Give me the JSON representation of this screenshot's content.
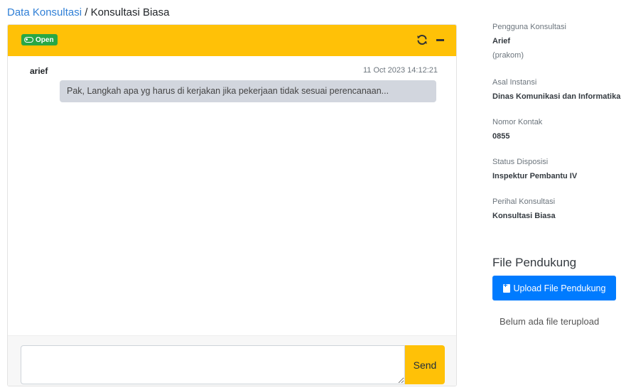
{
  "breadcrumb": {
    "parent": "Data Konsultasi",
    "separator": "/",
    "current": "Konsultasi Biasa"
  },
  "chat": {
    "status": "Open",
    "messages": [
      {
        "sender": "arief",
        "timestamp": "11 Oct 2023 14:12:21",
        "text": "Pak, Langkah apa yg harus di kerjakan jika pekerjaan tidak sesuai perencanaan..."
      }
    ],
    "input": {
      "value": "",
      "placeholder": ""
    },
    "send_label": "Send",
    "icons": {
      "refresh": "refresh-icon",
      "collapse": "minus-icon",
      "status": "toggle-on-icon"
    }
  },
  "info": {
    "user": {
      "label": "Pengguna Konsultasi",
      "name": "Arief",
      "role": "(prakom)"
    },
    "agency": {
      "label": "Asal Instansi",
      "value": "Dinas Komunikasi dan Informatika"
    },
    "contact": {
      "label": "Nomor Kontak",
      "value": "0855"
    },
    "disposition": {
      "label": "Status Disposisi",
      "value": "Inspektur Pembantu IV"
    },
    "subject": {
      "label": "Perihal Konsultasi",
      "value": "Konsultasi Biasa"
    }
  },
  "files": {
    "title": "File Pendukung",
    "upload_label": "Upload File Pendukung",
    "empty_text": "Belum ada file terupload"
  },
  "colors": {
    "header": "#ffc107",
    "badge": "#28a745",
    "primary": "#007bff",
    "link": "#2f7fd6",
    "bubble": "#d2d6de"
  }
}
